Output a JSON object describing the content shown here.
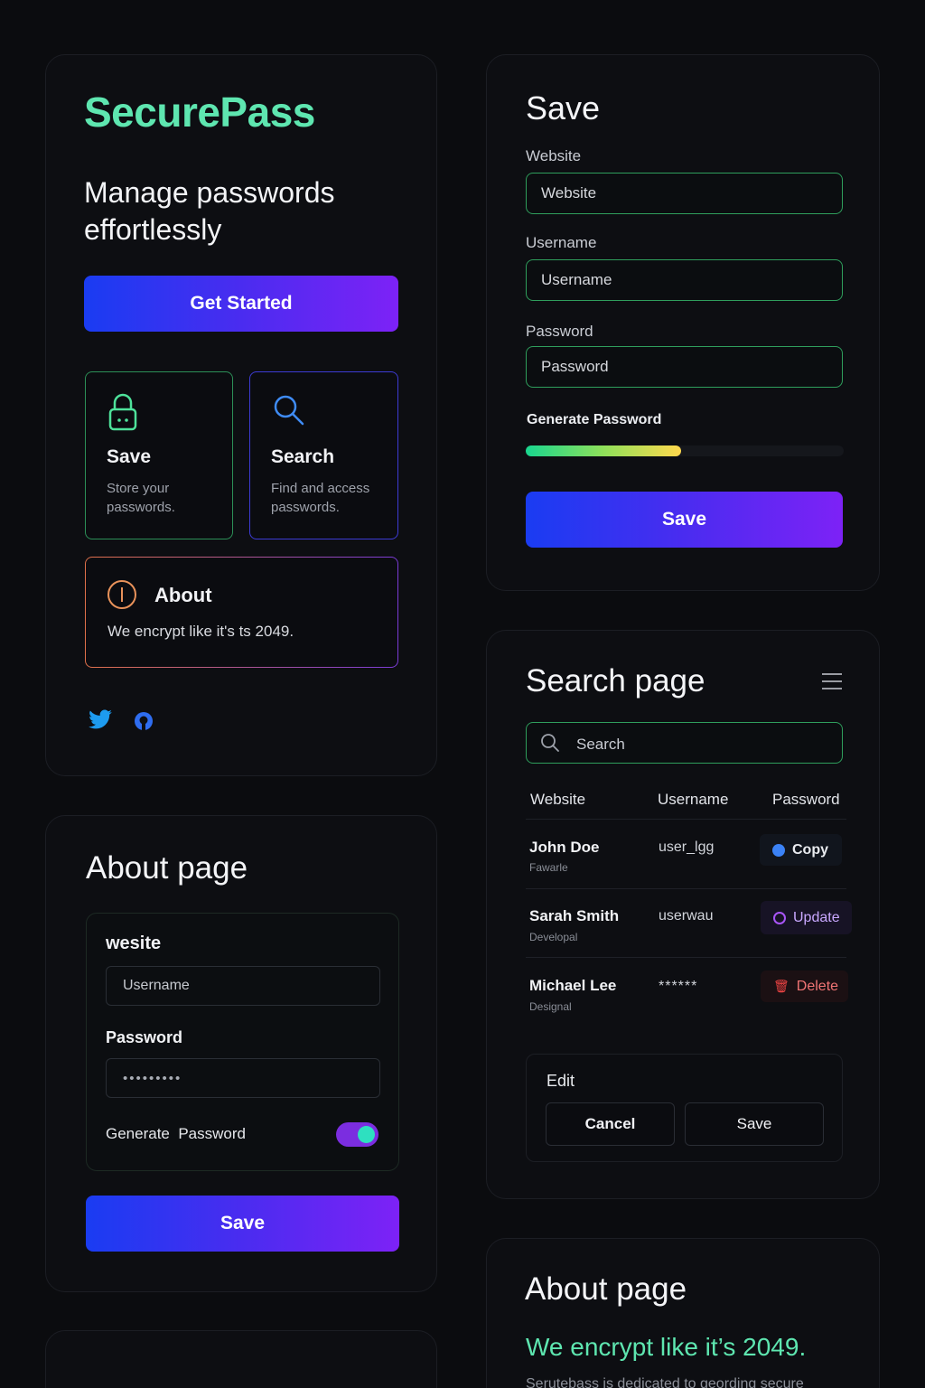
{
  "home": {
    "brand": "SecurePass",
    "tagline_line1": "Manage passwords",
    "tagline_line2": "effortlessly",
    "cta_label": "Get Started",
    "features": [
      {
        "title": "Save",
        "desc_line1": "Store your",
        "desc_line2": "passwords.",
        "icon": "lock-icon"
      },
      {
        "title": "Search",
        "desc_line1": "Find and access",
        "desc_line2": "passwords.",
        "icon": "search-icon"
      }
    ],
    "about": {
      "title": "About",
      "text": "We encrypt like it's ts 2049.",
      "icon": "info-icon"
    },
    "social": [
      "twitter-icon",
      "github-icon"
    ]
  },
  "save_page": {
    "title": "Save",
    "website_label": "Website",
    "website_placeholder": "Website",
    "username_label": "Username",
    "username_placeholder": "Username",
    "password_label": "Password",
    "password_placeholder": "Password",
    "generate_label": "Generate Password",
    "strength": 0.49,
    "save_label": "Save"
  },
  "about_form": {
    "title": "About page",
    "website_label": "wesite",
    "username_placeholder": "Username",
    "password_label": "Password",
    "password_value": "•••••••••",
    "generate_label": "Generate  Password",
    "toggle_on": true,
    "save_label": "Save"
  },
  "search_page": {
    "title": "Search page",
    "search_placeholder": "Search",
    "columns": [
      "Website",
      "Username",
      "Password"
    ],
    "rows": [
      {
        "name": "John Doe",
        "sub": "Fawarle",
        "username": "user_lgg",
        "action": "Copy",
        "action_color": "#3b82f6"
      },
      {
        "name": "Sarah Smith",
        "sub": "Developal",
        "username": "userwau",
        "action": "Update",
        "action_color": "#a855f7"
      },
      {
        "name": "Michael Lee",
        "sub": "Designal",
        "username": "******",
        "action": "Delete",
        "action_color": "#ef4444"
      }
    ],
    "edit": {
      "title": "Edit",
      "cancel_label": "Cancel",
      "save_label": "Save"
    }
  },
  "about_page": {
    "title": "About page",
    "headline": "We encrypt like it’s 2049.",
    "body": "Serutebass is dedicated to geording secure"
  },
  "colors": {
    "brand": "#5ee6b0",
    "accent_green": "#2f9e5c",
    "accent_purple": "#7d22f6",
    "accent_blue": "#1a3cf2",
    "about_orange": "#e8925a"
  }
}
